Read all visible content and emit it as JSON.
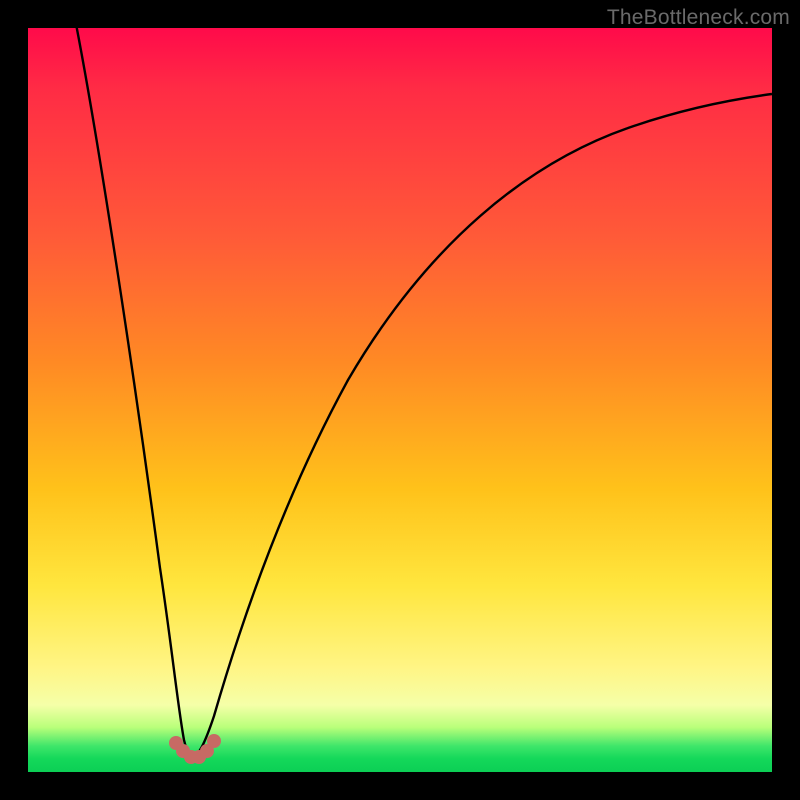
{
  "watermark": "TheBottleneck.com",
  "colors": {
    "marker": "#c76a64",
    "curve_stroke": "#000000"
  },
  "chart_data": {
    "type": "line",
    "title": "",
    "xlabel": "",
    "ylabel": "",
    "xlim": [
      0,
      100
    ],
    "ylim": [
      0,
      100
    ],
    "grid": false,
    "legend": false,
    "series": [
      {
        "name": "left-branch",
        "x": [
          6,
          8,
          10,
          12,
          14,
          16,
          18,
          19.5,
          20.5,
          21
        ],
        "y": [
          100,
          82,
          66,
          50,
          36,
          23,
          12,
          6,
          3,
          2
        ]
      },
      {
        "name": "right-branch",
        "x": [
          23,
          24,
          26,
          30,
          36,
          44,
          54,
          66,
          80,
          94,
          100
        ],
        "y": [
          2,
          4,
          12,
          30,
          48,
          62,
          73,
          81,
          86,
          89,
          90
        ]
      }
    ],
    "markers": {
      "name": "valley-highlight",
      "color": "#c76a64",
      "points": [
        {
          "x": 19.7,
          "y": 3.0
        },
        {
          "x": 20.3,
          "y": 2.0
        },
        {
          "x": 21.2,
          "y": 1.7
        },
        {
          "x": 22.1,
          "y": 1.7
        },
        {
          "x": 22.9,
          "y": 2.1
        },
        {
          "x": 23.6,
          "y": 3.2
        }
      ]
    }
  }
}
